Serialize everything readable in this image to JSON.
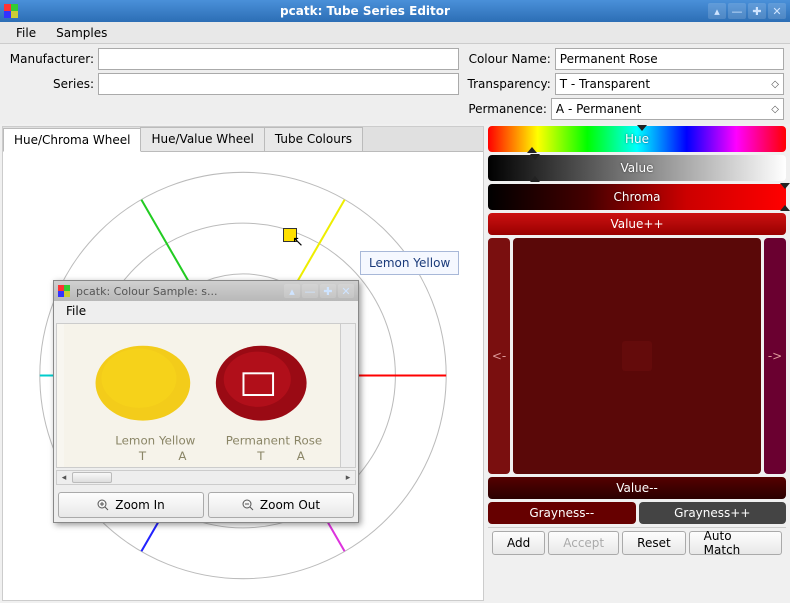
{
  "window": {
    "title": "pcatk: Tube Series Editor"
  },
  "menubar": {
    "file": "File",
    "samples": "Samples"
  },
  "form": {
    "manufacturer_label": "Manufacturer:",
    "manufacturer_value": "",
    "series_label": "Series:",
    "series_value": "",
    "colour_name_label": "Colour Name:",
    "colour_name_value": "Permanent Rose",
    "transparency_label": "Transparency:",
    "transparency_value": "T     - Transparent",
    "permanence_label": "Permanence:",
    "permanence_value": "A     - Permanent"
  },
  "tabs": {
    "hue_chroma": "Hue/Chroma Wheel",
    "hue_value": "Hue/Value Wheel",
    "tube_colours": "Tube Colours"
  },
  "tooltip": {
    "label": "Lemon Yellow"
  },
  "sample_window": {
    "title": "pcatk: Colour Sample: s...",
    "file": "File",
    "zoom_in": "Zoom In",
    "zoom_out": "Zoom Out",
    "swatch1_caption": "Lemon Yellow",
    "swatch2_caption": "Permanent Rose"
  },
  "sliders": {
    "hue": "Hue",
    "value": "Value",
    "chroma": "Chroma"
  },
  "adjust": {
    "value_pp": "Value++",
    "value_mm": "Value--",
    "left": "<-",
    "right": "->",
    "gray_mm": "Grayness--",
    "gray_pp": "Grayness++"
  },
  "footer": {
    "add": "Add",
    "accept": "Accept",
    "reset": "Reset",
    "auto_match": "Auto Match"
  }
}
